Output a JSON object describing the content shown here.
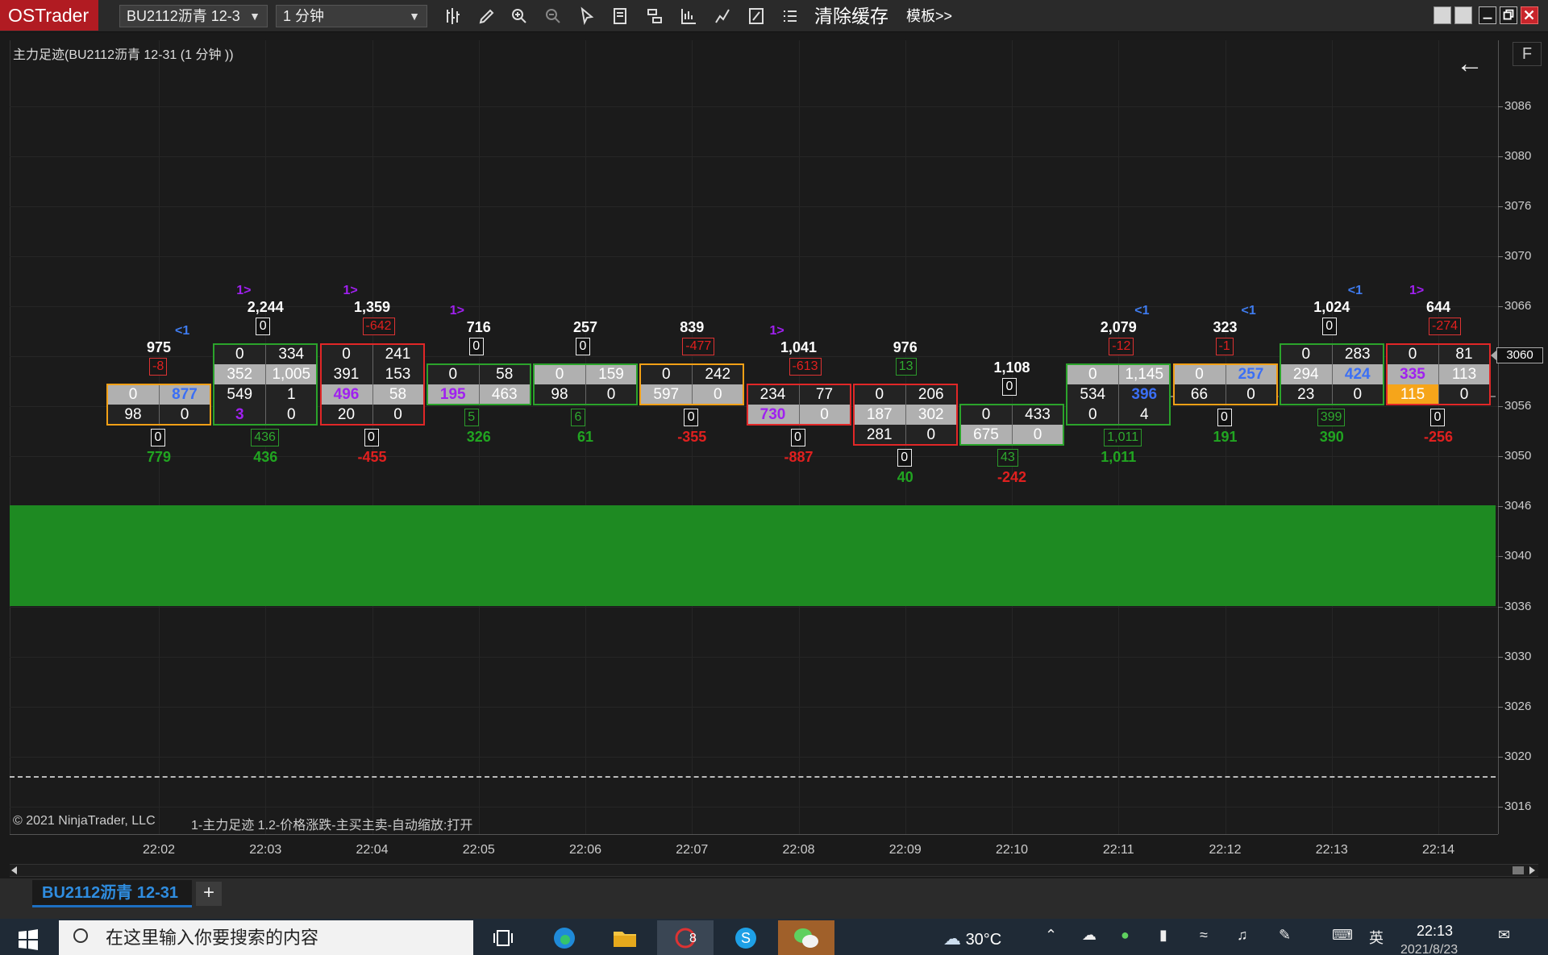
{
  "app": {
    "brand": "OSTrader",
    "instrument": "BU2112沥青 12-3",
    "timeframe": "1 分钟",
    "clear_cache": "清除缓存",
    "templates": "模板>>"
  },
  "chart": {
    "title": "主力足迹(BU2112沥青 12-31 (1 分钟 ))",
    "copyright": "© 2021 NinjaTrader, LLC",
    "indicator": "1-主力足迹 1.2-价格涨跌-主买主卖-自动缩放:打开",
    "f_button": "F",
    "current_price": "3060",
    "price_labels": [
      "3086",
      "3080",
      "3076",
      "3070",
      "3066",
      "3060",
      "3056",
      "3050",
      "3046",
      "3040",
      "3036",
      "3030",
      "3026",
      "3020",
      "3016"
    ],
    "time_labels": [
      "22:02",
      "22:03",
      "22:04",
      "22:05",
      "22:06",
      "22:07",
      "22:08",
      "22:09",
      "22:10",
      "22:11",
      "22:12",
      "22:13",
      "22:14"
    ],
    "colors": {
      "zone": "#1e8a22",
      "up": "#2ba32b",
      "down": "#e12727",
      "orange": "#f2a016",
      "purple": "#a020f0",
      "blue": "#3b6ff5"
    }
  },
  "bars": [
    {
      "time": "22:02",
      "volume": "975",
      "delta": "-8",
      "delta_color": "red",
      "signal": "<1",
      "signal_color": "b",
      "bottom_delta": "0",
      "bottom_total": "779",
      "bottom_total_color": "green",
      "rows": [
        [
          "0",
          "877"
        ],
        [
          "98",
          "0"
        ]
      ],
      "row_styles": [
        [
          "bg-g",
          "bg-g blue bold"
        ],
        [
          "bg-k",
          "bg-k"
        ]
      ],
      "border": "orange",
      "row_start": 4
    },
    {
      "time": "22:03",
      "volume": "2,244",
      "delta": "0",
      "delta_color": "white",
      "signal": "1>",
      "signal_color": "p",
      "bottom_delta": "436",
      "bottom_total": "436",
      "bottom_total_color": "green",
      "rows": [
        [
          "0",
          "334"
        ],
        [
          "352",
          "1,005"
        ],
        [
          "549",
          "1"
        ],
        [
          "3",
          "0"
        ]
      ],
      "row_styles": [
        [
          "bg-k",
          "bg-k"
        ],
        [
          "bg-g",
          "bg-g"
        ],
        [
          "bg-k",
          "bg-k"
        ],
        [
          "bg-k purple bold",
          "bg-k"
        ]
      ],
      "border": "green",
      "row_start": 2
    },
    {
      "time": "22:04",
      "volume": "1,359",
      "delta": "-642",
      "delta_color": "red",
      "signal": "1>",
      "signal_color": "p",
      "bottom_delta": "0",
      "bottom_total": "-455",
      "bottom_total_color": "red",
      "rows": [
        [
          "0",
          "241"
        ],
        [
          "391",
          "153"
        ],
        [
          "496",
          "58"
        ],
        [
          "20",
          "0"
        ]
      ],
      "row_styles": [
        [
          "bg-k",
          "bg-k"
        ],
        [
          "bg-k",
          "bg-k"
        ],
        [
          "bg-g purple bold",
          "bg-g"
        ],
        [
          "bg-k",
          "bg-k"
        ]
      ],
      "border": "red",
      "row_start": 2
    },
    {
      "time": "22:05",
      "volume": "716",
      "delta": "0",
      "delta_color": "white",
      "signal": "1>",
      "signal_color": "p",
      "bottom_delta": "5",
      "bottom_total": "326",
      "bottom_total_color": "green",
      "rows": [
        [
          "0",
          "58"
        ],
        [
          "195",
          "463"
        ]
      ],
      "row_styles": [
        [
          "bg-k",
          "bg-k"
        ],
        [
          "bg-g purple bold",
          "bg-g"
        ]
      ],
      "border": "green",
      "row_start": 3
    },
    {
      "time": "22:06",
      "volume": "257",
      "delta": "0",
      "delta_color": "white",
      "signal": "",
      "signal_color": "p",
      "bottom_delta": "6",
      "bottom_total": "61",
      "bottom_total_color": "green",
      "rows": [
        [
          "0",
          "159"
        ],
        [
          "98",
          "0"
        ]
      ],
      "row_styles": [
        [
          "bg-g",
          "bg-g"
        ],
        [
          "bg-k",
          "bg-k"
        ]
      ],
      "border": "green",
      "row_start": 3
    },
    {
      "time": "22:07",
      "volume": "839",
      "delta": "-477",
      "delta_color": "red",
      "signal": "",
      "signal_color": "p",
      "bottom_delta": "0",
      "bottom_total": "-355",
      "bottom_total_color": "red",
      "rows": [
        [
          "0",
          "242"
        ],
        [
          "597",
          "0"
        ]
      ],
      "row_styles": [
        [
          "bg-k",
          "bg-k"
        ],
        [
          "bg-g",
          "bg-g"
        ]
      ],
      "border": "orange",
      "row_start": 3
    },
    {
      "time": "22:08",
      "volume": "1,041",
      "delta": "-613",
      "delta_color": "red",
      "signal": "1>",
      "signal_color": "p",
      "bottom_delta": "0",
      "bottom_total": "-887",
      "bottom_total_color": "red",
      "rows": [
        [
          "234",
          "77"
        ],
        [
          "730",
          "0"
        ]
      ],
      "row_styles": [
        [
          "bg-k",
          "bg-k"
        ],
        [
          "bg-g purple bold",
          "bg-g"
        ]
      ],
      "border": "red",
      "row_start": 4
    },
    {
      "time": "22:09",
      "volume": "976",
      "delta": "13",
      "delta_color": "green",
      "signal": "",
      "signal_color": "p",
      "bottom_delta": "0",
      "bottom_total": "40",
      "bottom_total_color": "green",
      "rows": [
        [
          "0",
          "206"
        ],
        [
          "187",
          "302"
        ],
        [
          "281",
          "0"
        ]
      ],
      "row_styles": [
        [
          "bg-k",
          "bg-k"
        ],
        [
          "bg-g",
          "bg-g"
        ],
        [
          "bg-k",
          "bg-k"
        ]
      ],
      "border": "red",
      "row_start": 4
    },
    {
      "time": "22:10",
      "volume": "1,108",
      "delta": "0",
      "delta_color": "white",
      "signal": "",
      "signal_color": "p",
      "bottom_delta": "43",
      "bottom_total": "-242",
      "bottom_total_color": "red",
      "rows": [
        [
          "0",
          "433"
        ],
        [
          "675",
          "0"
        ]
      ],
      "row_styles": [
        [
          "bg-k",
          "bg-k"
        ],
        [
          "bg-g",
          "bg-g"
        ]
      ],
      "border": "green",
      "row_start": 5
    },
    {
      "time": "22:11",
      "volume": "2,079",
      "delta": "-12",
      "delta_color": "red",
      "signal": "<1",
      "signal_color": "b",
      "bottom_delta": "1,011",
      "bottom_total": "1,011",
      "bottom_total_color": "green",
      "rows": [
        [
          "0",
          "1,145"
        ],
        [
          "534",
          "396"
        ],
        [
          "0",
          "4"
        ]
      ],
      "row_styles": [
        [
          "bg-g",
          "bg-g"
        ],
        [
          "bg-k",
          "bg-k blue bold"
        ],
        [
          "bg-k",
          "bg-k"
        ]
      ],
      "border": "green",
      "row_start": 3
    },
    {
      "time": "22:12",
      "volume": "323",
      "delta": "-1",
      "delta_color": "red",
      "signal": "<1",
      "signal_color": "b",
      "bottom_delta": "0",
      "bottom_total": "191",
      "bottom_total_color": "green",
      "rows": [
        [
          "0",
          "257"
        ],
        [
          "66",
          "0"
        ]
      ],
      "row_styles": [
        [
          "bg-g",
          "bg-g blue bold"
        ],
        [
          "bg-k",
          "bg-k"
        ]
      ],
      "border": "orange",
      "row_start": 3
    },
    {
      "time": "22:13",
      "volume": "1,024",
      "delta": "0",
      "delta_color": "white",
      "signal": "<1",
      "signal_color": "b",
      "bottom_delta": "399",
      "bottom_total": "390",
      "bottom_total_color": "green",
      "rows": [
        [
          "0",
          "283"
        ],
        [
          "294",
          "424"
        ],
        [
          "23",
          "0"
        ]
      ],
      "row_styles": [
        [
          "bg-k",
          "bg-k"
        ],
        [
          "bg-g",
          "bg-g blue bold"
        ],
        [
          "bg-k",
          "bg-k"
        ]
      ],
      "border": "green",
      "row_start": 2
    },
    {
      "time": "22:14",
      "volume": "644",
      "delta": "-274",
      "delta_color": "red",
      "signal": "1>",
      "signal_color": "p",
      "bottom_delta": "0",
      "bottom_total": "-256",
      "bottom_total_color": "red",
      "rows": [
        [
          "0",
          "81"
        ],
        [
          "335",
          "113"
        ],
        [
          "115",
          "0"
        ]
      ],
      "row_styles": [
        [
          "bg-k",
          "bg-k"
        ],
        [
          "bg-g purple bold",
          "bg-g"
        ],
        [
          "bg-o",
          "bg-k"
        ]
      ],
      "border": "red",
      "row_start": 2
    }
  ],
  "tabs": {
    "active": "BU2112沥青 12-31",
    "add": "+"
  },
  "taskbar": {
    "search_placeholder": "在这里输入你要搜索的内容",
    "weather": "30°C",
    "ime": "英",
    "time": "22:13",
    "date": "2021/8/23",
    "notif_badge": "8"
  }
}
